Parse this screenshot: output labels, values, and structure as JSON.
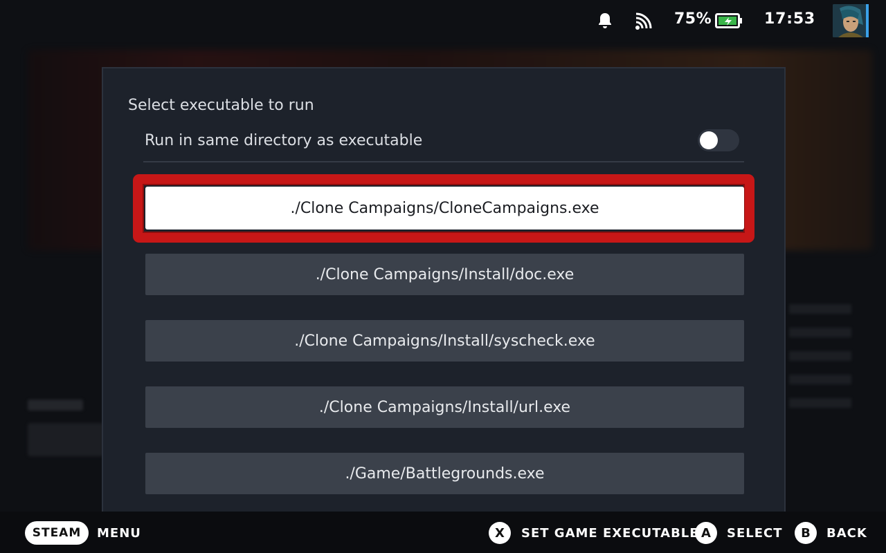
{
  "status": {
    "battery_percent": "75%",
    "time": "17:53",
    "icons": [
      "bell-icon",
      "wifi-icon",
      "battery-charging-icon"
    ]
  },
  "modal": {
    "title": "Select executable to run",
    "toggle": {
      "label": "Run in same directory as executable",
      "on": false
    },
    "executables": [
      {
        "label": "./Clone Campaigns/CloneCampaigns.exe",
        "focused": true
      },
      {
        "label": "./Clone Campaigns/Install/doc.exe",
        "focused": false
      },
      {
        "label": "./Clone Campaigns/Install/syscheck.exe",
        "focused": false
      },
      {
        "label": "./Clone Campaigns/Install/url.exe",
        "focused": false
      },
      {
        "label": "./Game/Battlegrounds.exe",
        "focused": false
      }
    ]
  },
  "footer": {
    "steam_label": "STEAM",
    "menu_label": "MENU",
    "hints": [
      {
        "glyph": "X",
        "label": "SET GAME EXECUTABLE"
      },
      {
        "glyph": "A",
        "label": "SELECT"
      },
      {
        "glyph": "B",
        "label": "BACK"
      }
    ]
  },
  "colors": {
    "focus_ring": "#c71717",
    "modal_bg": "#1d222b",
    "button_bg": "#3b414b"
  }
}
